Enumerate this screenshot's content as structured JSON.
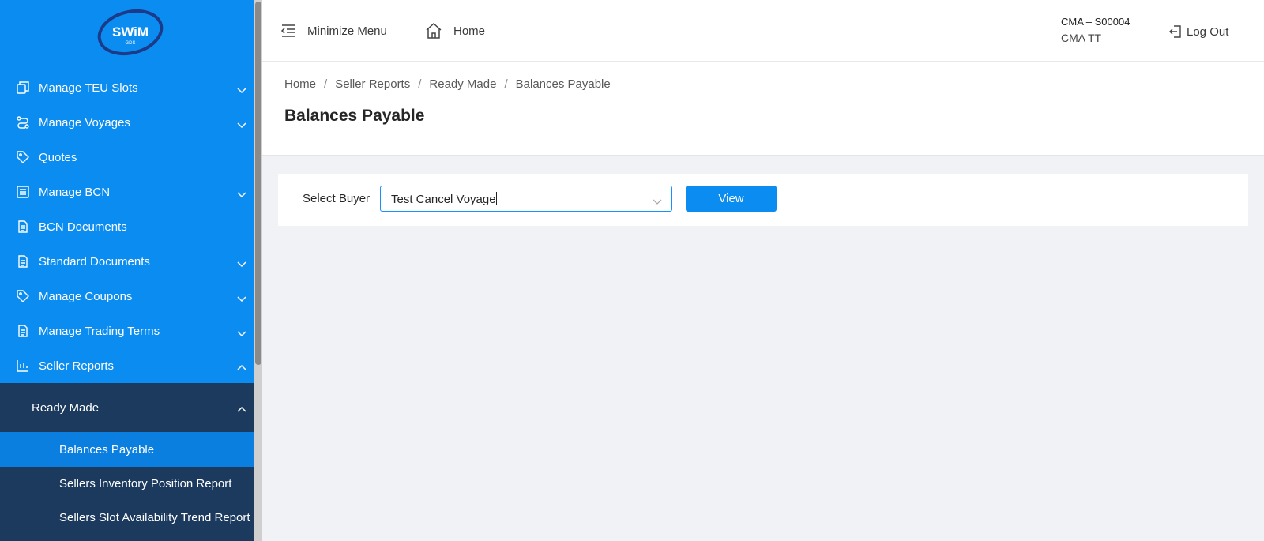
{
  "brand": {
    "logo_text": "SWiM",
    "logo_subtext": "GDS"
  },
  "sidebar": {
    "items": [
      {
        "label": "Manage TEU Slots",
        "icon": "copy-icon",
        "expandable": true
      },
      {
        "label": "Manage Voyages",
        "icon": "route-icon",
        "expandable": true
      },
      {
        "label": "Quotes",
        "icon": "tag-icon",
        "expandable": false
      },
      {
        "label": "Manage BCN",
        "icon": "list-icon",
        "expandable": true
      },
      {
        "label": "BCN Documents",
        "icon": "document-icon",
        "expandable": false
      },
      {
        "label": "Standard Documents",
        "icon": "document-icon",
        "expandable": true
      },
      {
        "label": "Manage Coupons",
        "icon": "tag-icon",
        "expandable": true
      },
      {
        "label": "Manage Trading Terms",
        "icon": "document-icon",
        "expandable": true
      },
      {
        "label": "Seller Reports",
        "icon": "bar-chart-icon",
        "expandable": true,
        "expanded": true
      }
    ],
    "submenu": {
      "label": "Ready Made",
      "items": [
        {
          "label": "Balances Payable",
          "active": true
        },
        {
          "label": "Sellers Inventory Position Report",
          "active": false
        },
        {
          "label": "Sellers Slot Availability Trend Report",
          "active": false
        }
      ]
    }
  },
  "topbar": {
    "minimize_label": "Minimize Menu",
    "home_label": "Home",
    "user_code": "CMA – S00004",
    "user_name": "CMA TT",
    "logout_label": "Log Out"
  },
  "breadcrumb": [
    "Home",
    "Seller Reports",
    "Ready Made",
    "Balances Payable"
  ],
  "page": {
    "title": "Balances Payable"
  },
  "filter": {
    "label": "Select Buyer",
    "value": "Test Cancel Voyage",
    "button_label": "View"
  },
  "colors": {
    "sidebar": "#0a8cf0",
    "submenu": "#1c3a5e",
    "active": "#0a7fe0",
    "accent": "#1890ff"
  }
}
